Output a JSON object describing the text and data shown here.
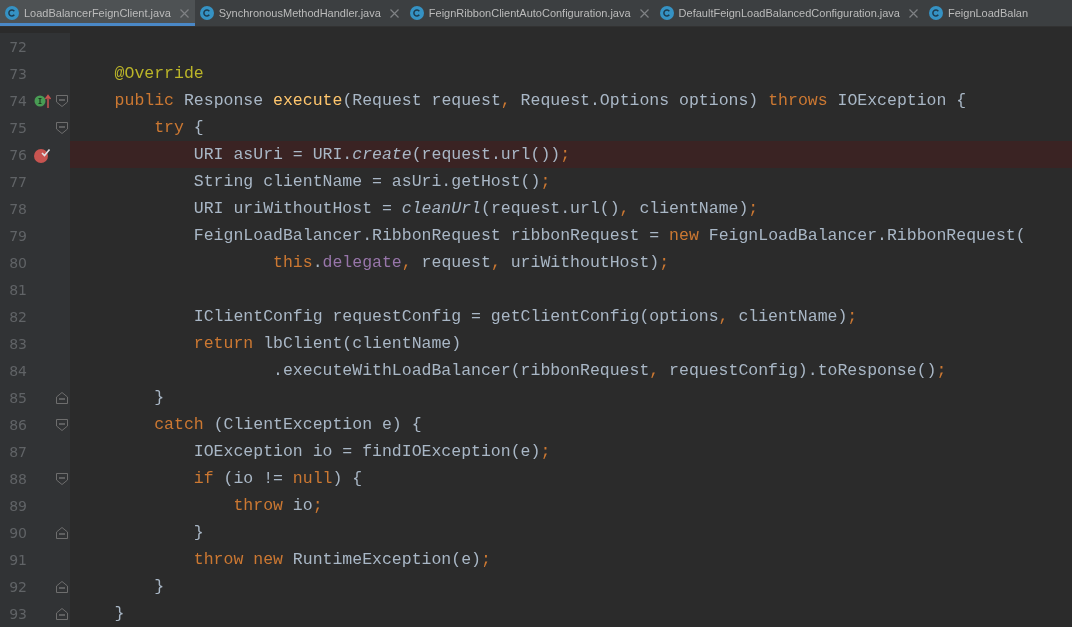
{
  "tabs": [
    {
      "label": "LoadBalancerFeignClient.java",
      "selected": true,
      "closable": true
    },
    {
      "label": "SynchronousMethodHandler.java",
      "selected": false,
      "closable": true
    },
    {
      "label": "FeignRibbonClientAutoConfiguration.java",
      "selected": false,
      "closable": true
    },
    {
      "label": "DefaultFeignLoadBalancedConfiguration.java",
      "selected": false,
      "closable": true
    },
    {
      "label": "FeignLoadBalan",
      "selected": false,
      "closable": false
    }
  ],
  "lines": [
    {
      "number": "72",
      "highlighted": false
    },
    {
      "number": "73",
      "highlighted": false,
      "tokens": [
        {
          "t": "    @Override",
          "kind": "ann"
        }
      ]
    },
    {
      "number": "74",
      "highlighted": false,
      "gutter_marks": [
        {
          "kind": "implements"
        },
        {
          "kind": "fold_open"
        }
      ],
      "tokens": [
        {
          "t": "    public",
          "kind": "kw"
        },
        {
          "t": " Response ",
          "kind": "p"
        },
        {
          "t": "execute",
          "kind": "fn"
        },
        {
          "t": "(Request request",
          "kind": "p"
        },
        {
          "t": ",",
          "kind": "kw"
        },
        {
          "t": " Request.Options options) ",
          "kind": "p"
        },
        {
          "t": "throws",
          "kind": "kw"
        },
        {
          "t": " IOException {",
          "kind": "p"
        }
      ]
    },
    {
      "number": "75",
      "highlighted": false,
      "gutter_marks": [
        {
          "kind": "fold_open"
        }
      ],
      "tokens": [
        {
          "t": "        try",
          "kind": "kw"
        },
        {
          "t": " {",
          "kind": "p"
        }
      ]
    },
    {
      "number": "76",
      "highlighted": true,
      "gutter_marks": [
        {
          "kind": "breakpoint"
        }
      ],
      "tokens": [
        {
          "t": "            URI asUri = URI.",
          "kind": "p"
        },
        {
          "t": "create",
          "kind": "it"
        },
        {
          "t": "(request.url())",
          "kind": "p"
        },
        {
          "t": ";",
          "kind": "kw"
        }
      ]
    },
    {
      "number": "77",
      "highlighted": false,
      "tokens": [
        {
          "t": "            String clientName = asUri.getHost()",
          "kind": "p"
        },
        {
          "t": ";",
          "kind": "kw"
        }
      ]
    },
    {
      "number": "78",
      "highlighted": false,
      "tokens": [
        {
          "t": "            URI uriWithoutHost = ",
          "kind": "p"
        },
        {
          "t": "cleanUrl",
          "kind": "it"
        },
        {
          "t": "(request.url()",
          "kind": "p"
        },
        {
          "t": ",",
          "kind": "kw"
        },
        {
          "t": " clientName)",
          "kind": "p"
        },
        {
          "t": ";",
          "kind": "kw"
        }
      ]
    },
    {
      "number": "79",
      "highlighted": false,
      "tokens": [
        {
          "t": "            FeignLoadBalancer.RibbonRequest ribbonRequest = ",
          "kind": "p"
        },
        {
          "t": "new",
          "kind": "kw"
        },
        {
          "t": " FeignLoadBalancer.RibbonRequest(",
          "kind": "p"
        }
      ]
    },
    {
      "number": "80",
      "highlighted": false,
      "tokens": [
        {
          "t": "                    this",
          "kind": "kw"
        },
        {
          "t": ".",
          "kind": "p"
        },
        {
          "t": "delegate",
          "kind": "fld"
        },
        {
          "t": ",",
          "kind": "kw"
        },
        {
          "t": " request",
          "kind": "p"
        },
        {
          "t": ",",
          "kind": "kw"
        },
        {
          "t": " uriWithoutHost)",
          "kind": "p"
        },
        {
          "t": ";",
          "kind": "kw"
        }
      ]
    },
    {
      "number": "81",
      "highlighted": false
    },
    {
      "number": "82",
      "highlighted": false,
      "tokens": [
        {
          "t": "            IClientConfig requestConfig = getClientConfig(options",
          "kind": "p"
        },
        {
          "t": ",",
          "kind": "kw"
        },
        {
          "t": " clientName)",
          "kind": "p"
        },
        {
          "t": ";",
          "kind": "kw"
        }
      ]
    },
    {
      "number": "83",
      "highlighted": false,
      "tokens": [
        {
          "t": "            return",
          "kind": "kw"
        },
        {
          "t": " lbClient(clientName)",
          "kind": "p"
        }
      ]
    },
    {
      "number": "84",
      "highlighted": false,
      "tokens": [
        {
          "t": "                    .executeWithLoadBalancer(ribbonRequest",
          "kind": "p"
        },
        {
          "t": ",",
          "kind": "kw"
        },
        {
          "t": " requestConfig).toResponse()",
          "kind": "p"
        },
        {
          "t": ";",
          "kind": "kw"
        }
      ]
    },
    {
      "number": "85",
      "highlighted": false,
      "gutter_marks": [
        {
          "kind": "fold_close"
        }
      ],
      "tokens": [
        {
          "t": "        }",
          "kind": "p"
        }
      ]
    },
    {
      "number": "86",
      "highlighted": false,
      "gutter_marks": [
        {
          "kind": "fold_open"
        }
      ],
      "tokens": [
        {
          "t": "        catch",
          "kind": "kw"
        },
        {
          "t": " (ClientException e) {",
          "kind": "p"
        }
      ]
    },
    {
      "number": "87",
      "highlighted": false,
      "tokens": [
        {
          "t": "            IOException io = findIOException(e)",
          "kind": "p"
        },
        {
          "t": ";",
          "kind": "kw"
        }
      ]
    },
    {
      "number": "88",
      "highlighted": false,
      "gutter_marks": [
        {
          "kind": "fold_open"
        }
      ],
      "tokens": [
        {
          "t": "            if",
          "kind": "kw"
        },
        {
          "t": " (io != ",
          "kind": "p"
        },
        {
          "t": "null",
          "kind": "kw"
        },
        {
          "t": ") {",
          "kind": "p"
        }
      ]
    },
    {
      "number": "89",
      "highlighted": false,
      "tokens": [
        {
          "t": "                throw",
          "kind": "kw"
        },
        {
          "t": " io",
          "kind": "p"
        },
        {
          "t": ";",
          "kind": "kw"
        }
      ]
    },
    {
      "number": "90",
      "highlighted": false,
      "gutter_marks": [
        {
          "kind": "fold_close"
        }
      ],
      "tokens": [
        {
          "t": "            }",
          "kind": "p"
        }
      ]
    },
    {
      "number": "91",
      "highlighted": false,
      "tokens": [
        {
          "t": "            throw",
          "kind": "kw"
        },
        {
          "t": " new",
          "kind": "kw"
        },
        {
          "t": " RuntimeException(e)",
          "kind": "p"
        },
        {
          "t": ";",
          "kind": "kw"
        }
      ]
    },
    {
      "number": "92",
      "highlighted": false,
      "gutter_marks": [
        {
          "kind": "fold_close"
        }
      ],
      "tokens": [
        {
          "t": "        }",
          "kind": "p"
        }
      ]
    },
    {
      "number": "93",
      "highlighted": false,
      "gutter_marks": [
        {
          "kind": "fold_close"
        }
      ],
      "tokens": [
        {
          "t": "    }",
          "kind": "p"
        }
      ]
    }
  ]
}
